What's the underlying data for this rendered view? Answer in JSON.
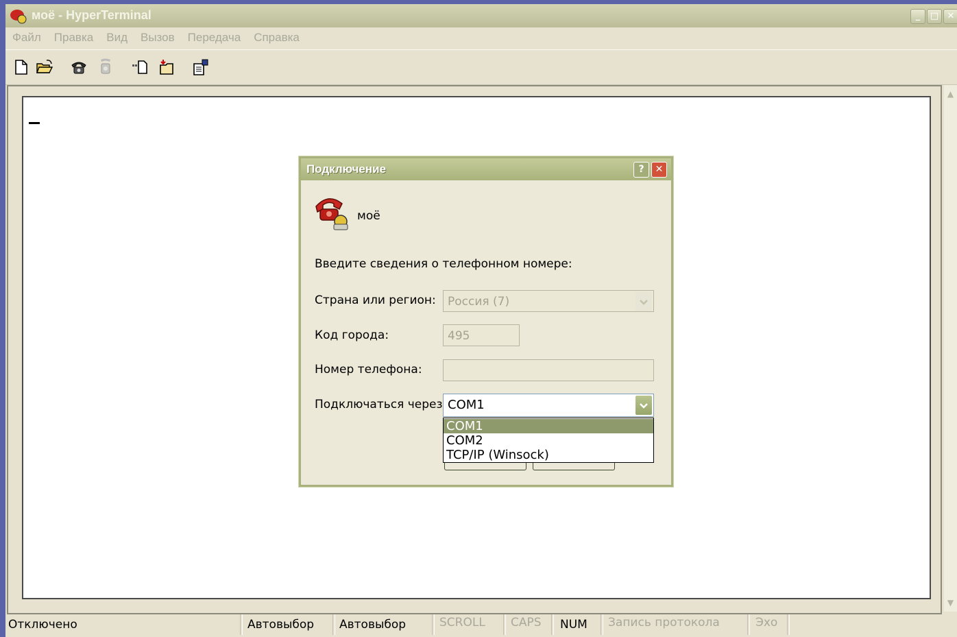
{
  "window": {
    "title": "моё - HyperTerminal"
  },
  "menu": [
    "Файл",
    "Правка",
    "Вид",
    "Вызов",
    "Передача",
    "Справка"
  ],
  "toolbar": {
    "icons": [
      "new-document-icon",
      "open-folder-icon",
      "phone-connect-icon",
      "phone-disconnect-icon",
      "send-file-icon",
      "receive-file-icon",
      "properties-icon"
    ]
  },
  "dialog": {
    "title": "Подключение",
    "help_label": "?",
    "close_label": "✕",
    "connection_name": "моё",
    "prompt": "Введите сведения о телефонном номере:",
    "country_label": "Страна или регион:",
    "country_value": "Россия (7)",
    "area_label": "Код города:",
    "area_value": "495",
    "phone_label": "Номер телефона:",
    "phone_value": "",
    "connect_label": "Подключаться через:",
    "connect_value": "COM1",
    "connect_options": [
      "COM1",
      "COM2",
      "TCP/IP (Winsock)"
    ]
  },
  "status": {
    "connection": "Отключено",
    "detect1": "Автовыбор",
    "detect2": "Автовыбор",
    "scroll": "SCROLL",
    "caps": "CAPS",
    "num": "NUM",
    "capture": "Запись протокола",
    "echo": "Эхо"
  }
}
